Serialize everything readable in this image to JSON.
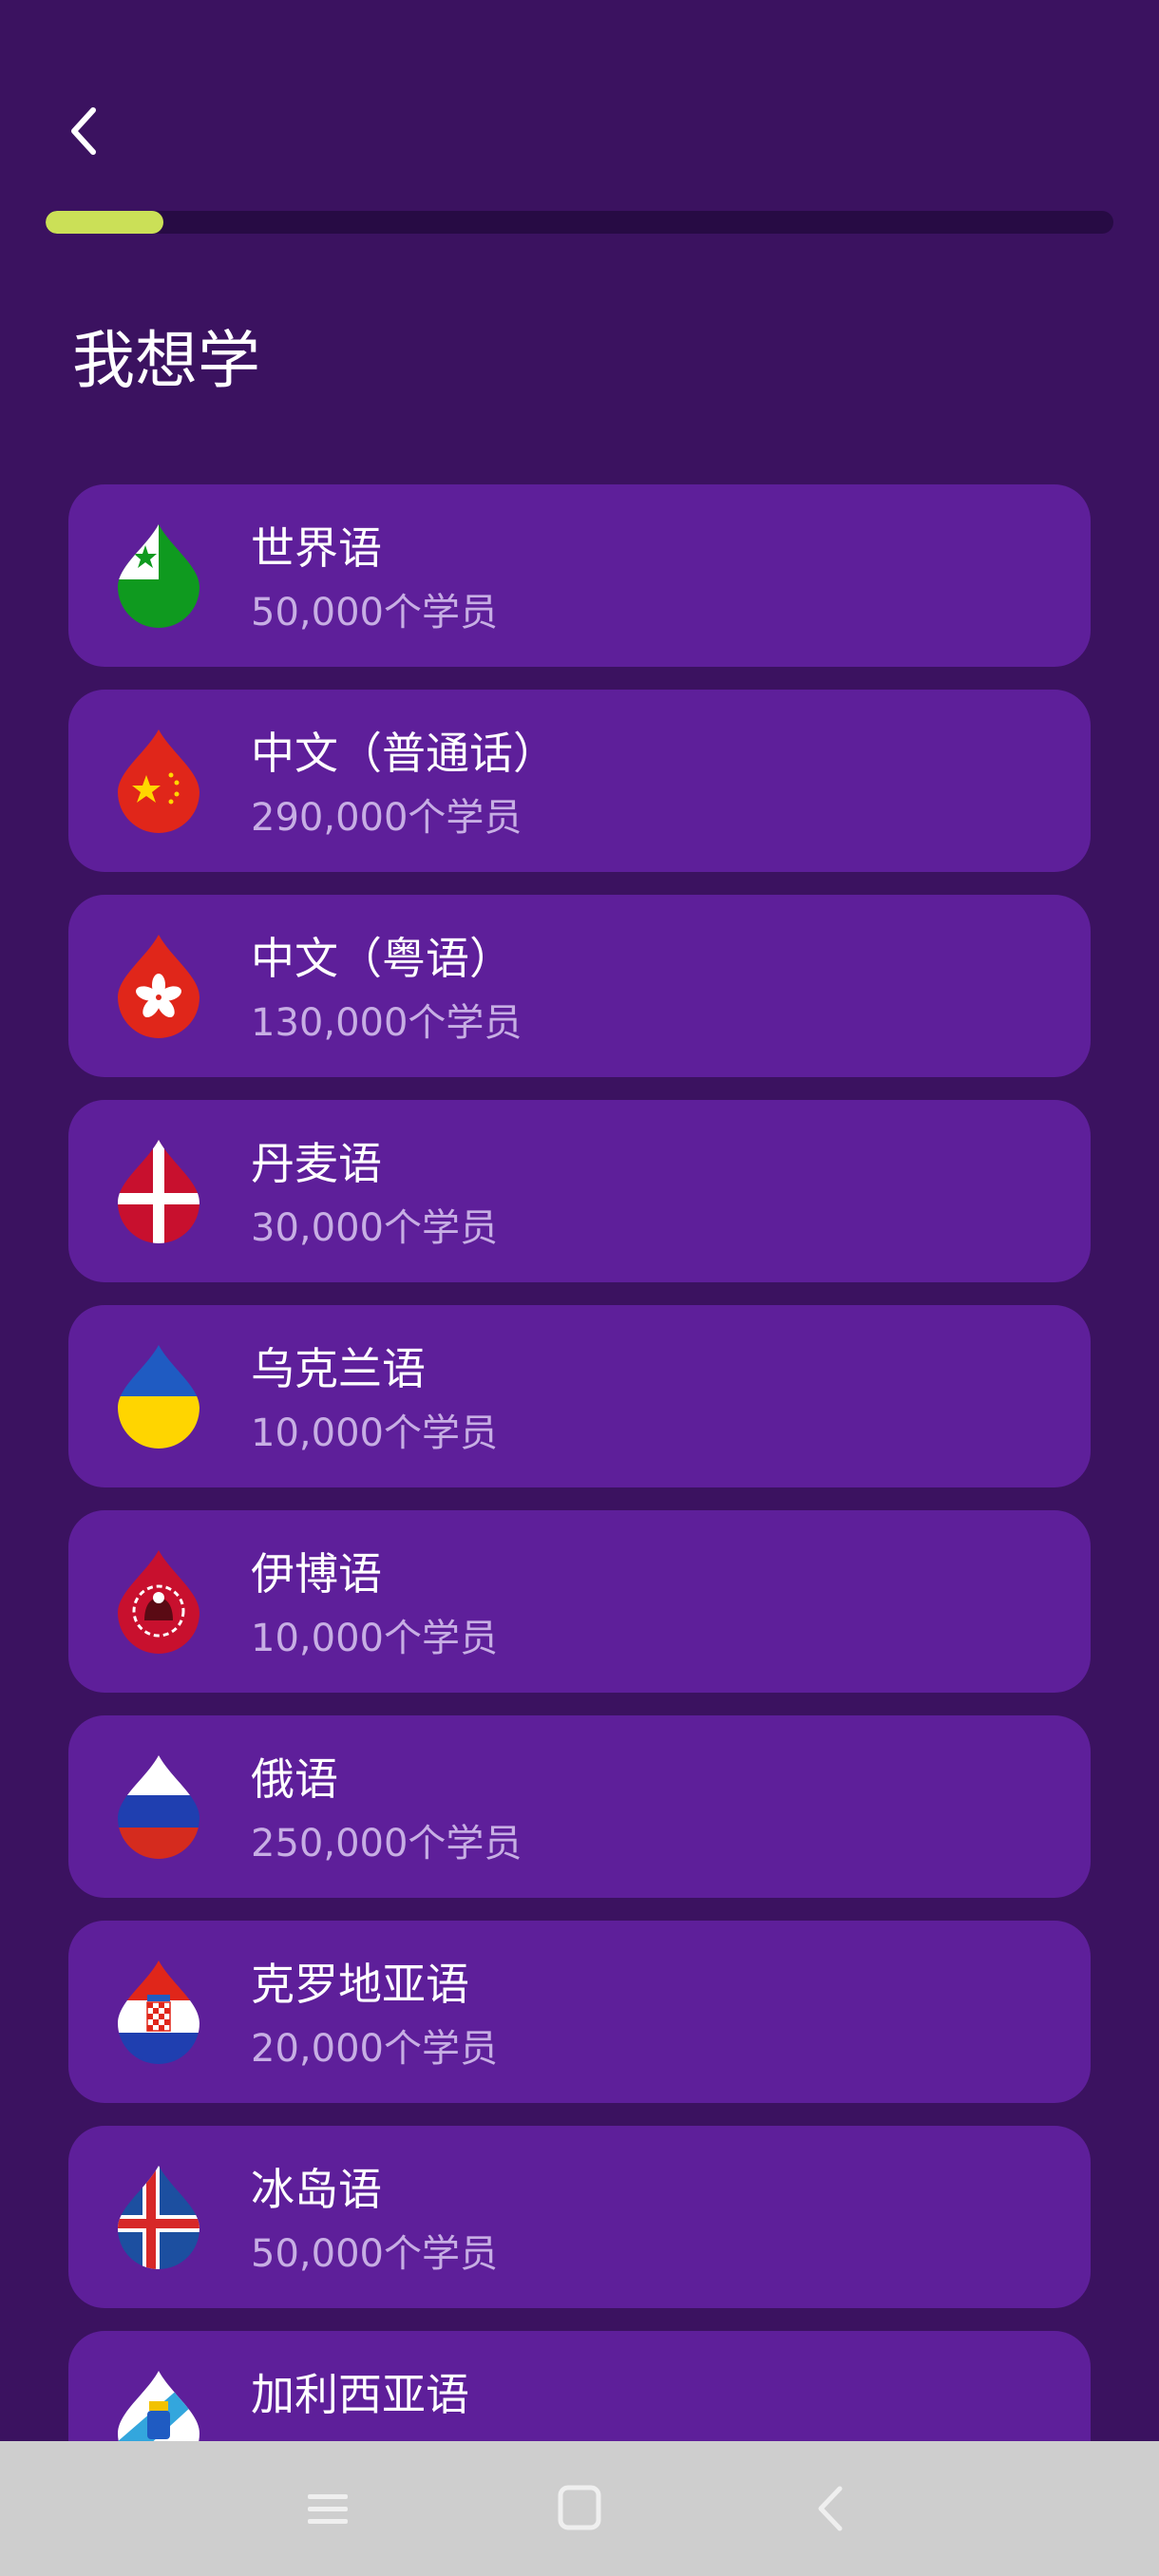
{
  "header": {
    "back_label": "",
    "progress": 0.11
  },
  "title": "我想学",
  "languages": [
    {
      "name": "世界语",
      "count": "50,000个学员",
      "flag": "esperanto-flag-icon"
    },
    {
      "name": "中文（普通话）",
      "count": "290,000个学员",
      "flag": "china-flag-icon"
    },
    {
      "name": "中文（粤语）",
      "count": "130,000个学员",
      "flag": "hong-kong-flag-icon"
    },
    {
      "name": "丹麦语",
      "count": "30,000个学员",
      "flag": "denmark-flag-icon"
    },
    {
      "name": "乌克兰语",
      "count": "10,000个学员",
      "flag": "ukraine-flag-icon"
    },
    {
      "name": "伊博语",
      "count": "10,000个学员",
      "flag": "igbo-flag-icon"
    },
    {
      "name": "俄语",
      "count": "250,000个学员",
      "flag": "russia-flag-icon"
    },
    {
      "name": "克罗地亚语",
      "count": "20,000个学员",
      "flag": "croatia-flag-icon"
    },
    {
      "name": "冰岛语",
      "count": "50,000个学员",
      "flag": "iceland-flag-icon"
    },
    {
      "name": "加利西亚语",
      "count": "",
      "flag": "galicia-flag-icon"
    }
  ],
  "colors": {
    "background": "#3b1260",
    "card": "#5e1f9a",
    "progress_fill": "#cbe057",
    "progress_track": "#270b44",
    "secondary_text": "#c7aee4"
  }
}
